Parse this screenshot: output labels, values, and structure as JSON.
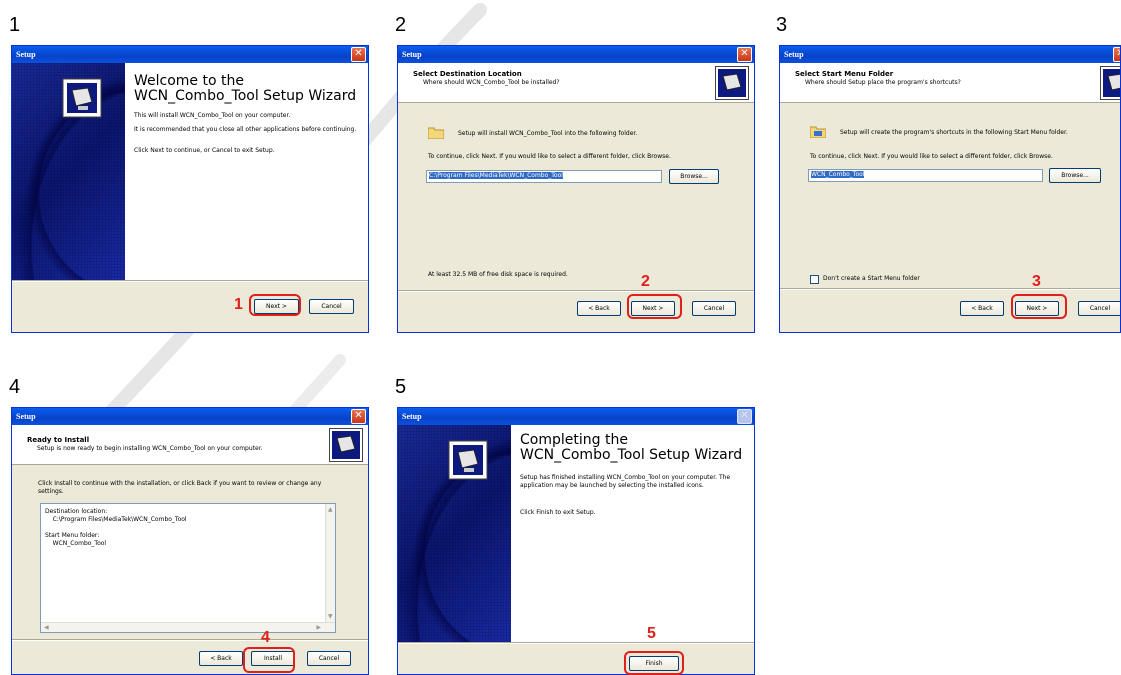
{
  "steps": [
    {
      "number": "1",
      "title": "Setup",
      "heading": "Welcome to the WCN_Combo_Tool Setup Wizard",
      "lines": [
        "This will install WCN_Combo_Tool on your computer.",
        "It is recommended that you close all other applications before continuing.",
        "Click Next to continue, or Cancel to exit Setup."
      ],
      "buttons": {
        "next": "Next >",
        "cancel": "Cancel"
      },
      "marker": "1"
    },
    {
      "number": "2",
      "title": "Setup",
      "header_title": "Select Destination Location",
      "header_sub": "Where should WCN_Combo_Tool be installed?",
      "install_text": "Setup will install WCN_Combo_Tool into the following folder.",
      "continue_text": "To continue, click Next. If you would like to select a different folder, click Browse.",
      "path": "C:\\Program Files\\MediaTek\\WCN_Combo_Tool",
      "browse": "Browse...",
      "disk_text": "At least 32.5 MB of free disk space is required.",
      "buttons": {
        "back": "< Back",
        "next": "Next >",
        "cancel": "Cancel"
      },
      "marker": "2"
    },
    {
      "number": "3",
      "title": "Setup",
      "header_title": "Select Start Menu Folder",
      "header_sub": "Where should Setup place the program's shortcuts?",
      "install_text": "Setup will create the program's shortcuts in the following Start Menu folder.",
      "continue_text": "To continue, click Next. If you would like to select a different folder, click Browse.",
      "path": "WCN_Combo_Tool",
      "browse": "Browse...",
      "checkbox_label": "Don't create a Start Menu folder",
      "buttons": {
        "back": "< Back",
        "next": "Next >",
        "cancel": "Cancel"
      },
      "marker": "3"
    },
    {
      "number": "4",
      "title": "Setup",
      "header_title": "Ready to Install",
      "header_sub": "Setup is now ready to begin installing WCN_Combo_Tool on your computer.",
      "intro": "Click Install to continue with the installation, or click Back if you want to review or change any settings.",
      "summary": "Destination location:\n    C:\\Program Files\\MediaTek\\WCN_Combo_Tool\n\nStart Menu folder:\n    WCN_Combo_Tool",
      "buttons": {
        "back": "< Back",
        "install": "Install",
        "cancel": "Cancel"
      },
      "marker": "4"
    },
    {
      "number": "5",
      "title": "Setup",
      "heading": "Completing the WCN_Combo_Tool Setup Wizard",
      "lines": [
        "Setup has finished installing WCN_Combo_Tool on your computer. The application may be launched by selecting the installed icons.",
        "Click Finish to exit Setup."
      ],
      "buttons": {
        "finish": "Finish"
      },
      "marker": "5"
    }
  ],
  "colors": {
    "highlight": "#e0201a",
    "titlebar": "#0842c8",
    "dialog_bg": "#ece9d8"
  }
}
